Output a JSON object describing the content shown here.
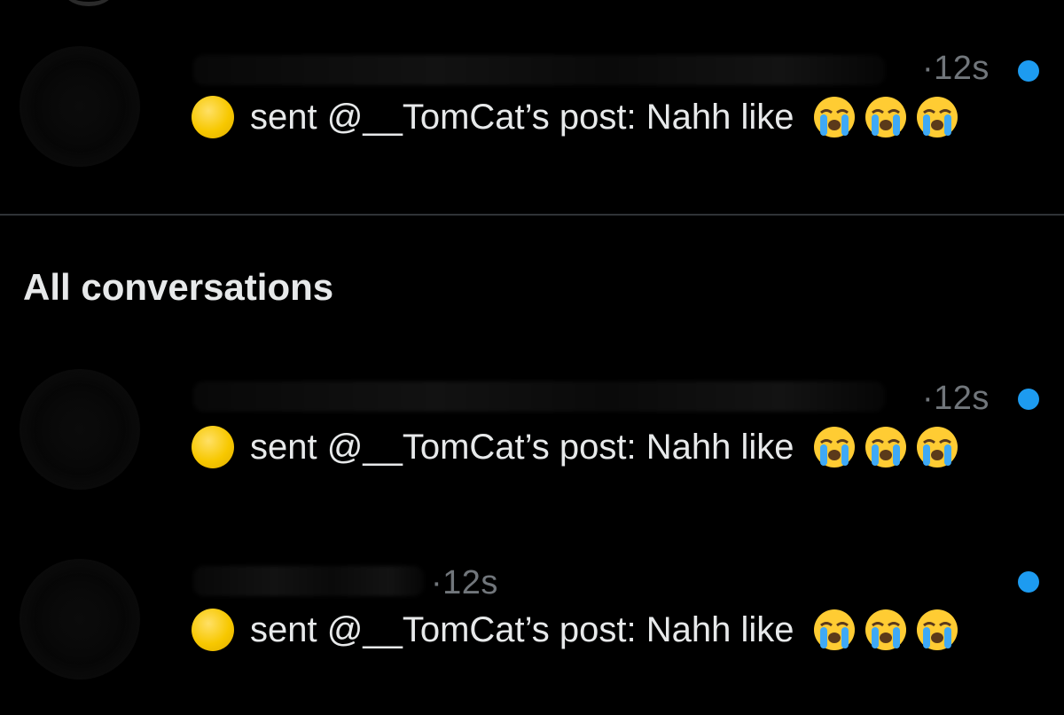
{
  "pinned_conversations": [
    {
      "timestamp": "·12s",
      "unread": true,
      "preview_text": "sent @__TomCat’s post: Nahh like",
      "reaction_icons": [
        "crying-face-emoji",
        "crying-face-emoji",
        "crying-face-emoji"
      ]
    }
  ],
  "all_conversations_section": {
    "title": "All conversations"
  },
  "conversations": [
    {
      "timestamp": "·12s",
      "unread": true,
      "preview_text": "sent @__TomCat’s post: Nahh like",
      "reaction_icons": [
        "crying-face-emoji",
        "crying-face-emoji",
        "crying-face-emoji"
      ]
    },
    {
      "timestamp": "·12s",
      "unread": true,
      "preview_text": "sent @__TomCat’s post: Nahh like",
      "reaction_icons": [
        "crying-face-emoji",
        "crying-face-emoji",
        "crying-face-emoji"
      ]
    }
  ],
  "colors": {
    "background": "#000000",
    "text_primary": "#e7e9ea",
    "text_secondary": "#71767b",
    "unread_dot": "#1d9bf0",
    "divider": "#2f3336",
    "sender_icon": "#f7c800"
  }
}
